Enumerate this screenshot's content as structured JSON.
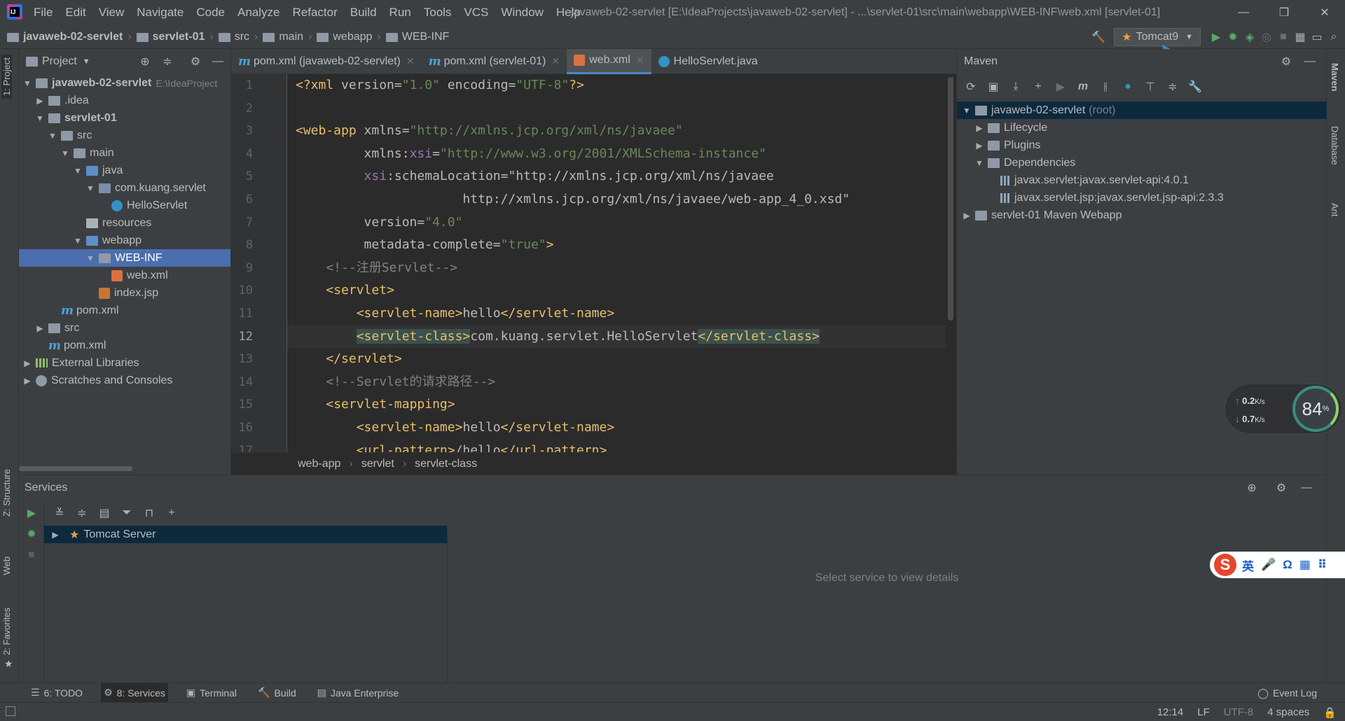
{
  "menubar": {
    "logo_text": "IJ",
    "items": [
      "File",
      "Edit",
      "View",
      "Navigate",
      "Code",
      "Analyze",
      "Refactor",
      "Build",
      "Run",
      "Tools",
      "VCS",
      "Window",
      "Help"
    ],
    "window_title": "javaweb-02-servlet [E:\\IdeaProjects\\javaweb-02-servlet] - ...\\servlet-01\\src\\main\\webapp\\WEB-INF\\web.xml [servlet-01]"
  },
  "navbar": {
    "breadcrumbs": [
      "javaweb-02-servlet",
      "servlet-01",
      "src",
      "main",
      "webapp",
      "WEB-INF"
    ],
    "run_config": "Tomcat9"
  },
  "left_stripe": {
    "project": "1: Project",
    "structure": "Z: Structure",
    "web": "Web",
    "favorites": "2: Favorites"
  },
  "right_stripe": {
    "maven": "Maven",
    "database": "Database",
    "ant": "Ant"
  },
  "project": {
    "title": "Project",
    "tree": [
      {
        "label": "javaweb-02-servlet",
        "hint": "E:\\IdeaProject",
        "depth": 0,
        "arrow": "▼",
        "icon": "module-folder",
        "bold": true
      },
      {
        "label": ".idea",
        "depth": 1,
        "arrow": "▶",
        "icon": "folder"
      },
      {
        "label": "servlet-01",
        "depth": 1,
        "arrow": "▼",
        "icon": "module-folder",
        "bold": true
      },
      {
        "label": "src",
        "depth": 2,
        "arrow": "▼",
        "icon": "folder"
      },
      {
        "label": "main",
        "depth": 3,
        "arrow": "▼",
        "icon": "folder"
      },
      {
        "label": "java",
        "depth": 4,
        "arrow": "▼",
        "icon": "source-folder"
      },
      {
        "label": "com.kuang.servlet",
        "depth": 5,
        "arrow": "▼",
        "icon": "package"
      },
      {
        "label": "HelloServlet",
        "depth": 6,
        "arrow": "",
        "icon": "class"
      },
      {
        "label": "resources",
        "depth": 4,
        "arrow": "",
        "icon": "resources-folder"
      },
      {
        "label": "webapp",
        "depth": 4,
        "arrow": "▼",
        "icon": "web-folder"
      },
      {
        "label": "WEB-INF",
        "depth": 5,
        "arrow": "▼",
        "icon": "folder",
        "selected": true
      },
      {
        "label": "web.xml",
        "depth": 6,
        "arrow": "",
        "icon": "xml"
      },
      {
        "label": "index.jsp",
        "depth": 5,
        "arrow": "",
        "icon": "jsp"
      },
      {
        "label": "pom.xml",
        "depth": 2,
        "arrow": "",
        "icon": "maven"
      },
      {
        "label": "src",
        "depth": 1,
        "arrow": "▶",
        "icon": "folder"
      },
      {
        "label": "pom.xml",
        "depth": 1,
        "arrow": "",
        "icon": "maven"
      },
      {
        "label": "External Libraries",
        "depth": 0,
        "arrow": "▶",
        "icon": "library"
      },
      {
        "label": "Scratches and Consoles",
        "depth": 0,
        "arrow": "▶",
        "icon": "scratch"
      }
    ]
  },
  "editor": {
    "tabs": [
      {
        "label": "pom.xml (javaweb-02-servlet)",
        "icon": "m"
      },
      {
        "label": "pom.xml (servlet-01)",
        "icon": "m"
      },
      {
        "label": "web.xml",
        "icon": "xml",
        "active": true
      },
      {
        "label": "HelloServlet.java",
        "icon": "c"
      }
    ],
    "current_line": 12,
    "lines": [
      "<?xml version=\"1.0\" encoding=\"UTF-8\"?>",
      "",
      "<web-app xmlns=\"http://xmlns.jcp.org/xml/ns/javaee\"",
      "         xmlns:xsi=\"http://www.w3.org/2001/XMLSchema-instance\"",
      "         xsi:schemaLocation=\"http://xmlns.jcp.org/xml/ns/javaee",
      "                      http://xmlns.jcp.org/xml/ns/javaee/web-app_4_0.xsd\"",
      "         version=\"4.0\"",
      "         metadata-complete=\"true\">",
      "    <!--注册Servlet-->",
      "    <servlet>",
      "        <servlet-name>hello</servlet-name>",
      "        <servlet-class>com.kuang.servlet.HelloServlet</servlet-class>",
      "    </servlet>",
      "    <!--Servlet的请求路径-->",
      "    <servlet-mapping>",
      "        <servlet-name>hello</servlet-name>",
      "        <url-pattern>/hello</url-pattern>"
    ],
    "breadcrumb": [
      "web-app",
      "servlet",
      "servlet-class"
    ]
  },
  "maven": {
    "title": "Maven",
    "tree": [
      {
        "label": "javaweb-02-servlet",
        "suffix": "(root)",
        "depth": 0,
        "arrow": "▼",
        "icon": "maven-module",
        "selected": true
      },
      {
        "label": "Lifecycle",
        "depth": 1,
        "arrow": "▶",
        "icon": "folder-gear"
      },
      {
        "label": "Plugins",
        "depth": 1,
        "arrow": "▶",
        "icon": "folder-gear"
      },
      {
        "label": "Dependencies",
        "depth": 1,
        "arrow": "▼",
        "icon": "folder-lib"
      },
      {
        "label": "javax.servlet:javax.servlet-api:4.0.1",
        "depth": 2,
        "arrow": "",
        "icon": "dependency"
      },
      {
        "label": "javax.servlet.jsp:javax.servlet.jsp-api:2.3.3",
        "depth": 2,
        "arrow": "",
        "icon": "dependency"
      },
      {
        "label": "servlet-01 Maven Webapp",
        "depth": 0,
        "arrow": "▶",
        "icon": "maven-module"
      }
    ]
  },
  "net_widget": {
    "upload": "0.2",
    "upload_unit": "K/s",
    "download": "0.7",
    "download_unit": "K/s",
    "percent": "84",
    "percent_unit": "%"
  },
  "services": {
    "title": "Services",
    "items": [
      {
        "label": "Tomcat Server",
        "arrow": "▶"
      }
    ],
    "empty_text": "Select service to view details"
  },
  "ime": {
    "logo": "S",
    "labels": [
      "英",
      "🎤",
      "Ω",
      "▦",
      "⠿"
    ]
  },
  "bottom_tools": [
    {
      "label": "6: TODO",
      "icon": "☰"
    },
    {
      "label": "8: Services",
      "icon": "⚙",
      "active": true
    },
    {
      "label": "Terminal",
      "icon": "▣"
    },
    {
      "label": "Build",
      "icon": "🔨"
    },
    {
      "label": "Java Enterprise",
      "icon": "▤"
    }
  ],
  "event_log": "Event Log",
  "status": {
    "position": "12:14",
    "line_sep": "LF",
    "encoding": "UTF-8",
    "indent": "4 spaces"
  },
  "colors": {
    "accent": "#4b6eaf",
    "selection_dark": "#0d293e",
    "tag": "#e8bf6a",
    "string": "#6a8759",
    "namespace": "#9876aa",
    "comment": "#808080"
  }
}
